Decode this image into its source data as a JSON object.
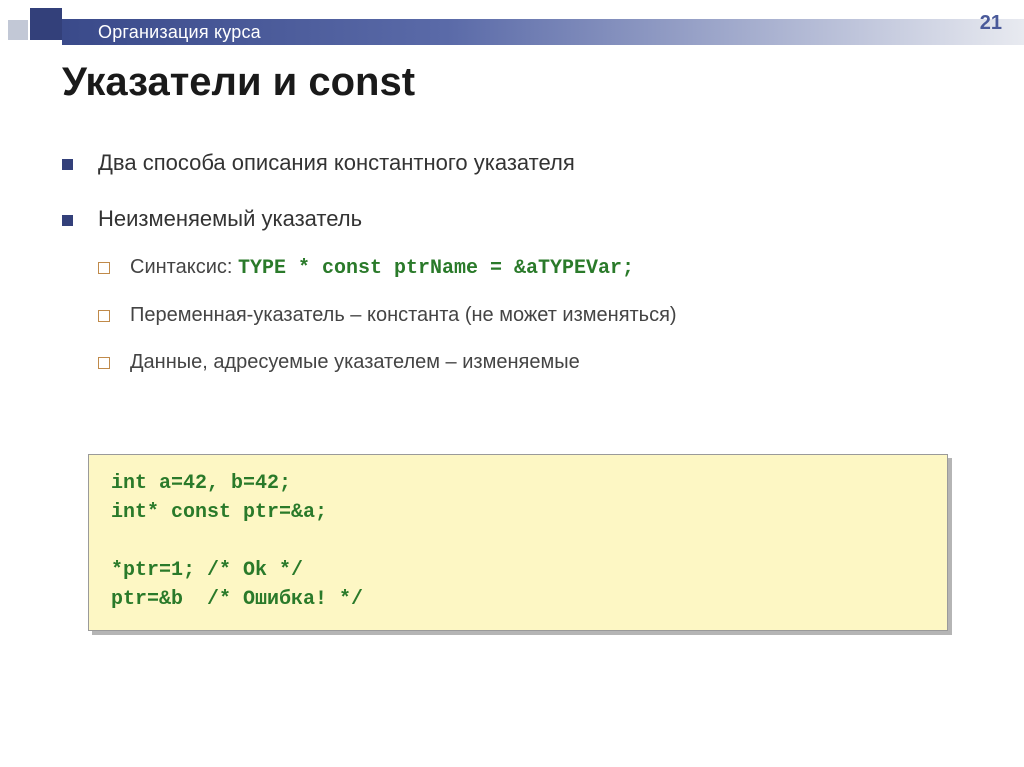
{
  "header": {
    "breadcrumb": "Организация курса",
    "page_number": "21"
  },
  "title": "Указатели и const",
  "bullets": {
    "b1": "Два способа описания константного указателя",
    "b2": "Неизменяемый указатель",
    "sub": {
      "s1_prefix": "Синтаксис: ",
      "s1_code": "TYPE * const ptrName = &aTYPEVar;",
      "s2": "Переменная-указатель – константа (не может изменяться)",
      "s3": "Данные, адресуемые указателем – изменяемые"
    }
  },
  "code_block": "int a=42, b=42;\nint* const ptr=&a;\n\n*ptr=1; /* Ok */\nptr=&b  /* Ошибка! */"
}
